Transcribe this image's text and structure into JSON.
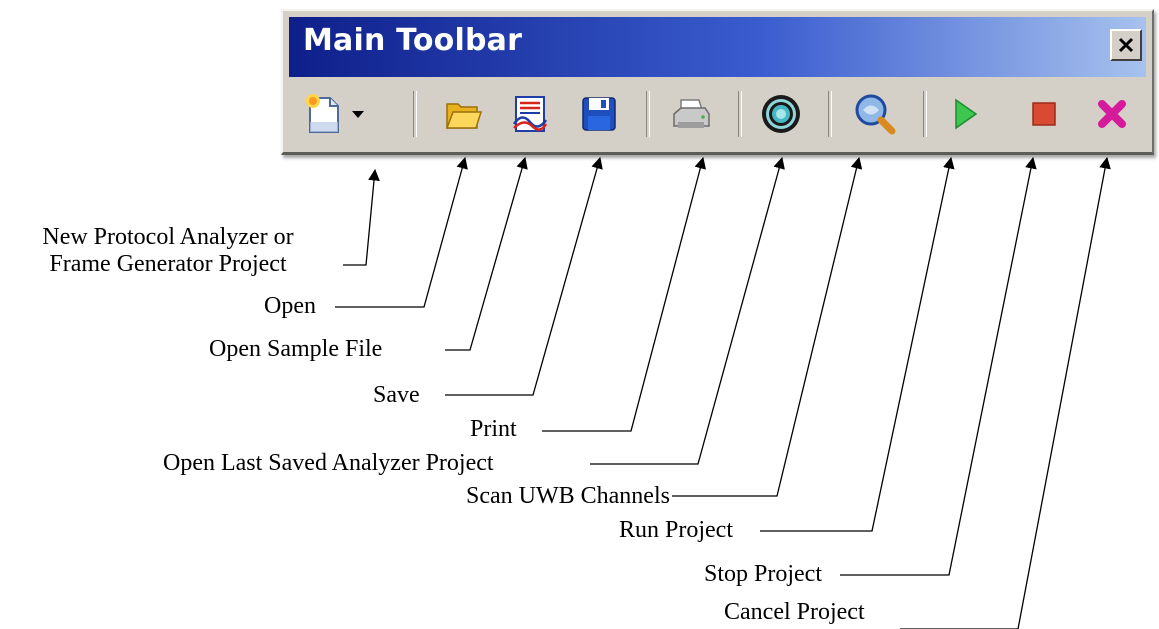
{
  "toolbar": {
    "title": "Main Toolbar",
    "close_symbol": "×",
    "buttons": [
      {
        "name": "new-project-button",
        "icon": "new-document-icon"
      },
      {
        "name": "new-project-dropdown",
        "icon": "chevron-down-icon"
      },
      {
        "name": "open-button",
        "icon": "folder-icon"
      },
      {
        "name": "open-sample-file-button",
        "icon": "sample-file-icon"
      },
      {
        "name": "save-button",
        "icon": "floppy-disk-icon"
      },
      {
        "name": "print-button",
        "icon": "printer-icon"
      },
      {
        "name": "open-last-saved-button",
        "icon": "target-icon"
      },
      {
        "name": "scan-uwb-channels-button",
        "icon": "magnifier-icon"
      },
      {
        "name": "run-project-button",
        "icon": "play-icon"
      },
      {
        "name": "stop-project-button",
        "icon": "stop-icon"
      },
      {
        "name": "cancel-project-button",
        "icon": "cancel-x-icon"
      }
    ],
    "colors": {
      "title_start": "#0e1f8a",
      "title_end": "#a7c2ee",
      "face": "#d4d0c8",
      "play": "#39c24a",
      "stop": "#d94a33",
      "cancel": "#d61a9c"
    }
  },
  "callouts": {
    "new_project_line1": "New Protocol Analyzer or",
    "new_project_line2": "Frame Generator Project",
    "open": "Open",
    "open_sample_file": "Open Sample File",
    "save": "Save",
    "print": "Print",
    "open_last_saved": "Open Last Saved Analyzer Project",
    "scan_uwb": "Scan UWB Channels",
    "run_project": "Run Project",
    "stop_project": "Stop Project",
    "cancel_project": "Cancel Project"
  }
}
